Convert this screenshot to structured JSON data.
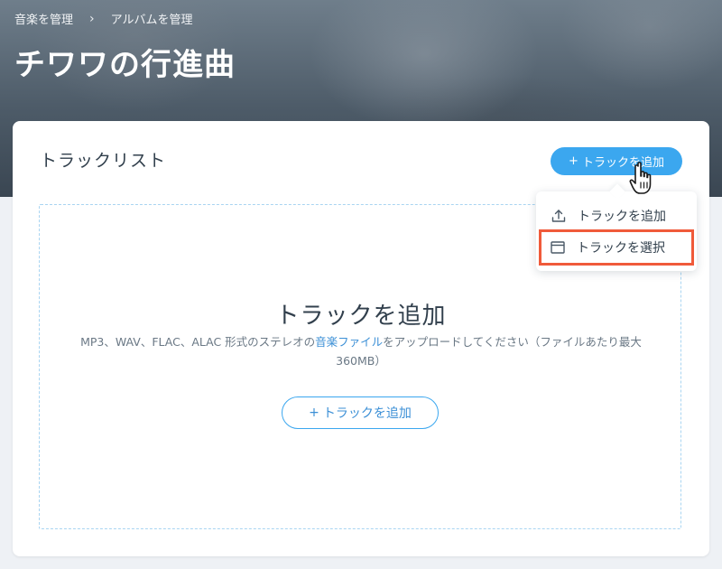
{
  "breadcrumb": {
    "items": [
      "音楽を管理",
      "アルバムを管理"
    ],
    "separator": "›"
  },
  "page": {
    "title": "チワワの行進曲"
  },
  "track_list": {
    "title": "トラックリスト",
    "add_button_label": "トラックを追加",
    "add_button_plus": "+"
  },
  "dropdown": {
    "items": [
      {
        "label": "トラックを追加",
        "icon": "upload-icon"
      },
      {
        "label": "トラックを選択",
        "icon": "window-icon",
        "highlighted": true
      }
    ]
  },
  "drop_zone": {
    "title": "トラックを追加",
    "desc_prefix": "MP3、WAV、FLAC、ALAC 形式のステレオの",
    "desc_link": "音楽ファイル",
    "desc_suffix": "をアップロードしてください（ファイルあたり最大",
    "desc_line2": "360MB）",
    "button_plus": "+",
    "button_label": "トラックを追加"
  },
  "colors": {
    "accent": "#3ba7ef",
    "highlight_border": "#f05a3a",
    "text_dark": "#32404d"
  }
}
